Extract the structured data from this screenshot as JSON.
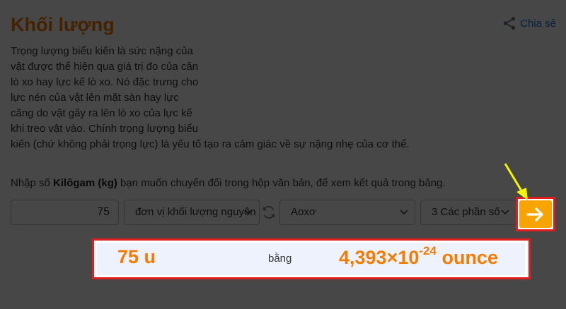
{
  "header": {
    "title": "Khối lượng",
    "share_label": "Chia sẻ"
  },
  "description": "Trọng lượng biểu kiến là sức nặng của vật được thể hiện qua giá trị đo của cân lò xo hay lực kế lò xo. Nó đặc trưng cho lực nén của vật lên mặt sàn hay lực căng do vật gây ra lên lò xo của lực kế khi treo vật vào. Chính trọng lượng biểu kiến (chứ không phải trọng lực) là yếu tố tạo ra cảm giác về sự nặng nhẹ của cơ thể.",
  "prompt": {
    "before": "Nhập số ",
    "unit": "Kilôgam (kg)",
    "after": " bạn muốn chuyển đổi trong hộp văn bản, để xem kết quả trong bảng."
  },
  "converter": {
    "input_value": "75",
    "from_unit": "đơn vị khối lượng nguyên tử",
    "to_unit": "Aoxơ",
    "precision": "3 Các phần số"
  },
  "result": {
    "left": "75 u",
    "middle": "bằng",
    "right_base": "4,393×10",
    "right_exp": "-24",
    "right_unit": " ounce"
  },
  "colors": {
    "accent": "#f57c00",
    "button": "#f7a300",
    "highlight_border": "#e01e1e",
    "pointer": "#f5f500",
    "link": "#1a73e8"
  },
  "icons": {
    "share": "share-icon",
    "swap": "swap-icon",
    "go": "arrow-right-icon",
    "pointer": "pointer-arrow-icon"
  }
}
